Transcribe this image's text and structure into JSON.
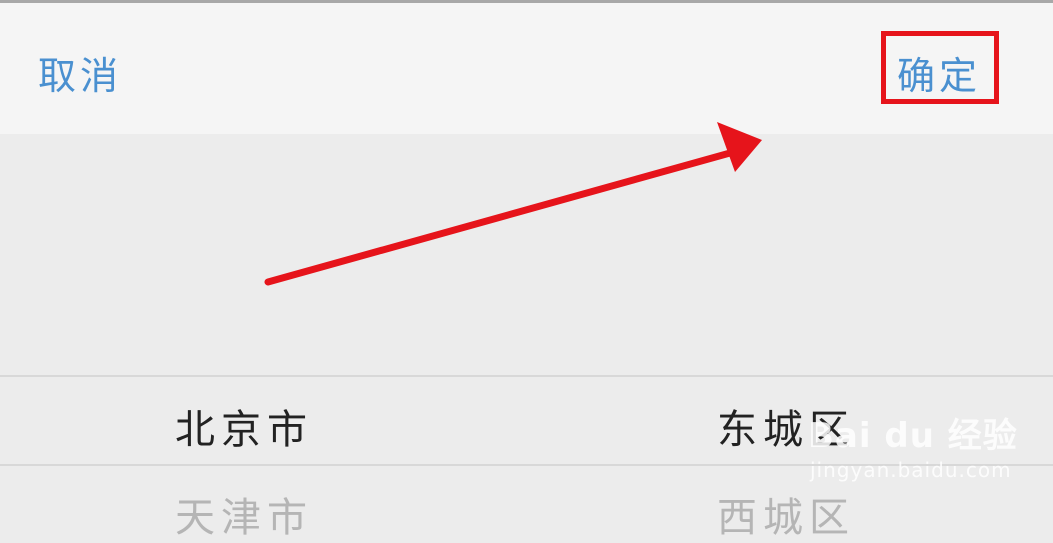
{
  "toolbar": {
    "cancel_label": "取消",
    "confirm_label": "确定"
  },
  "picker": {
    "province": {
      "selected": "北京市",
      "next": "天津市"
    },
    "district": {
      "selected": "东城区",
      "next": "西城区"
    }
  },
  "watermark": {
    "brand": "Bai du 经验",
    "url": "jingyan.baidu.com"
  },
  "colors": {
    "accent": "#4a90d0",
    "annotation": "#e6141b"
  }
}
